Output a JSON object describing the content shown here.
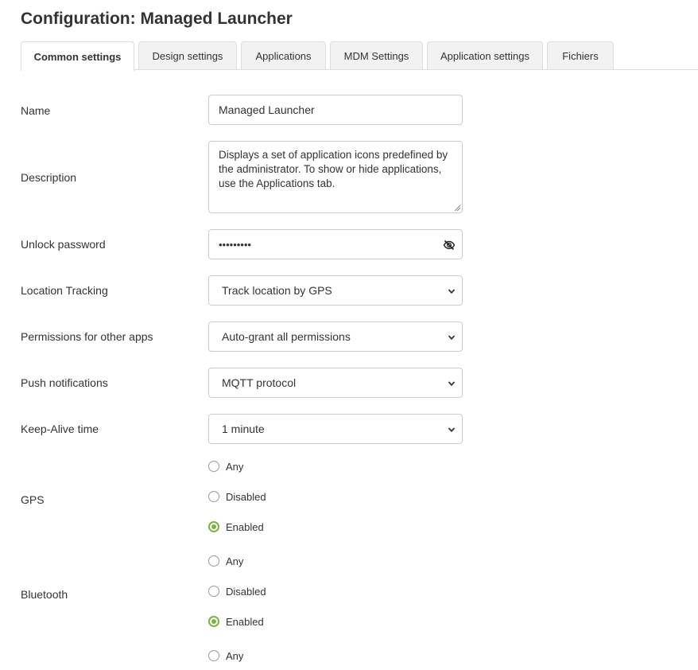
{
  "page": {
    "title": "Configuration: Managed Launcher"
  },
  "tabs": [
    {
      "label": "Common settings",
      "active": true
    },
    {
      "label": "Design settings",
      "active": false
    },
    {
      "label": "Applications",
      "active": false
    },
    {
      "label": "MDM Settings",
      "active": false
    },
    {
      "label": "Application settings",
      "active": false
    },
    {
      "label": "Fichiers",
      "active": false
    }
  ],
  "form": {
    "name": {
      "label": "Name",
      "value": "Managed Launcher"
    },
    "description": {
      "label": "Description",
      "value": "Displays a set of application icons predefined by the administrator. To show or hide applications, use the Applications tab."
    },
    "unlock_password": {
      "label": "Unlock password",
      "value": "•••••••••",
      "icon": "eye-slash-icon"
    },
    "location_tracking": {
      "label": "Location Tracking",
      "value": "Track location by GPS"
    },
    "permissions": {
      "label": "Permissions for other apps",
      "value": "Auto-grant all permissions"
    },
    "push_notifications": {
      "label": "Push notifications",
      "value": "MQTT protocol"
    },
    "keep_alive": {
      "label": "Keep-Alive time",
      "value": "1 minute"
    },
    "gps": {
      "label": "GPS",
      "options": [
        "Any",
        "Disabled",
        "Enabled"
      ],
      "selected": "Enabled"
    },
    "bluetooth": {
      "label": "Bluetooth",
      "options": [
        "Any",
        "Disabled",
        "Enabled"
      ],
      "selected": "Enabled"
    },
    "next_group": {
      "options": [
        "Any"
      ]
    }
  },
  "colors": {
    "accent_green": "#7cb342",
    "border": "#cccccc",
    "tab_bg": "#f2f2f2"
  }
}
